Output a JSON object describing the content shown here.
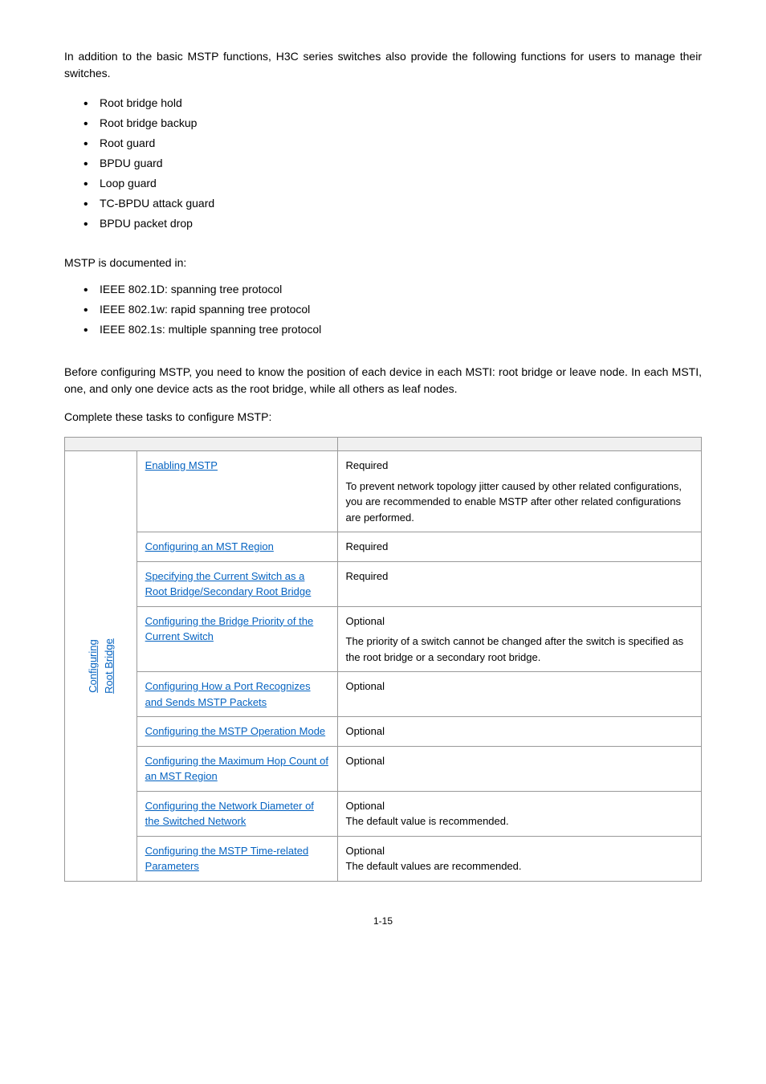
{
  "intro": "In addition to the basic MSTP functions, H3C series switches also provide the following functions for users to manage their switches.",
  "bullets1": [
    "Root bridge hold",
    "Root bridge backup",
    "Root guard",
    "BPDU guard",
    "Loop guard",
    "TC-BPDU attack guard",
    "BPDU packet drop"
  ],
  "docline": "MSTP is documented in:",
  "bullets2": [
    "IEEE 802.1D: spanning tree protocol",
    "IEEE 802.1w: rapid spanning tree protocol",
    "IEEE 802.1s: multiple spanning tree protocol"
  ],
  "before": "Before configuring MSTP, you need to know the position of each device in each MSTI: root bridge or leave node. In each MSTI, one, and only one device acts as the root bridge, while all others as leaf nodes.",
  "complete": "Complete these tasks to configure MSTP:",
  "sidelink1": "Configuring",
  "sidelink2": "Root Bridge",
  "rows": [
    {
      "task": "Enabling MSTP",
      "remark_title": "Required",
      "remark_body": "To prevent network topology jitter caused by other related configurations, you are recommended to enable MSTP after other related configurations are performed."
    },
    {
      "task": "Configuring an MST Region",
      "remark_title": "Required",
      "remark_body": ""
    },
    {
      "task": "Specifying the Current Switch as a Root Bridge/Secondary Root Bridge",
      "remark_title": "Required",
      "remark_body": ""
    },
    {
      "task": "Configuring the Bridge Priority of the Current Switch",
      "remark_title": "Optional",
      "remark_body": "The priority of a switch cannot be changed after the switch is specified as the root bridge or a secondary root bridge."
    },
    {
      "task": "Configuring How a Port Recognizes and Sends MSTP Packets",
      "remark_title": "Optional",
      "remark_body": ""
    },
    {
      "task": "Configuring the MSTP Operation Mode",
      "remark_title": "Optional",
      "remark_body": ""
    },
    {
      "task": "Configuring the Maximum Hop Count of an MST Region",
      "remark_title": "Optional",
      "remark_body": ""
    },
    {
      "task": "Configuring the Network Diameter of the Switched Network",
      "remark_title": "Optional",
      "remark_body": "The default value is recommended."
    },
    {
      "task": "Configuring the MSTP Time-related Parameters",
      "remark_title": "Optional",
      "remark_body": "The default values are recommended."
    }
  ],
  "pagenum": "1-15"
}
